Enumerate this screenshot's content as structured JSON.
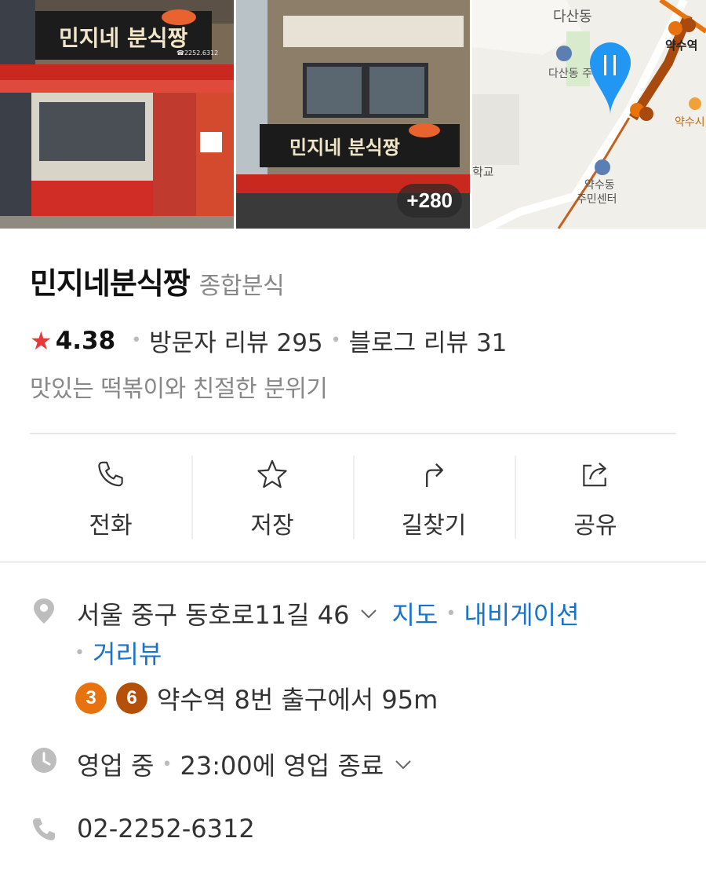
{
  "photos": {
    "more_count": "+280",
    "sign_text": "민지네 분식짱",
    "sign_phone": "☎2252.6312",
    "map_labels": {
      "district_top": "다산동",
      "office_1": "다산동 주민센",
      "station": "약수역",
      "school_fragment": "학교",
      "office_2_line1": "약수동",
      "office_2_line2": "주민센터",
      "corner": "약수시"
    }
  },
  "place": {
    "name": "민지네분식짱",
    "category": "종합분식",
    "rating": "4.38",
    "visitor_reviews": "방문자 리뷰 295",
    "blog_reviews": "블로그 리뷰 31",
    "tagline": "맛있는 떡볶이와 친절한 분위기"
  },
  "actions": {
    "call": "전화",
    "save": "저장",
    "directions": "길찾기",
    "share": "공유"
  },
  "address": {
    "text": "서울 중구 동호로11길 46",
    "map_link": "지도",
    "navigation_link": "내비게이션",
    "street_view_link": "거리뷰"
  },
  "subway": {
    "line_a": "3",
    "line_b": "6",
    "line_a_color": "#e8730e",
    "line_b_color": "#b5500b",
    "directions": "약수역 8번 출구에서 95m"
  },
  "hours": {
    "status": "영업 중",
    "close_time": "23:00에 영업 종료"
  },
  "phone": {
    "number": "02-2252-6312"
  },
  "colors": {
    "star": "#e8393a",
    "link": "#1a73c9",
    "map_pin": "#2196f3"
  }
}
